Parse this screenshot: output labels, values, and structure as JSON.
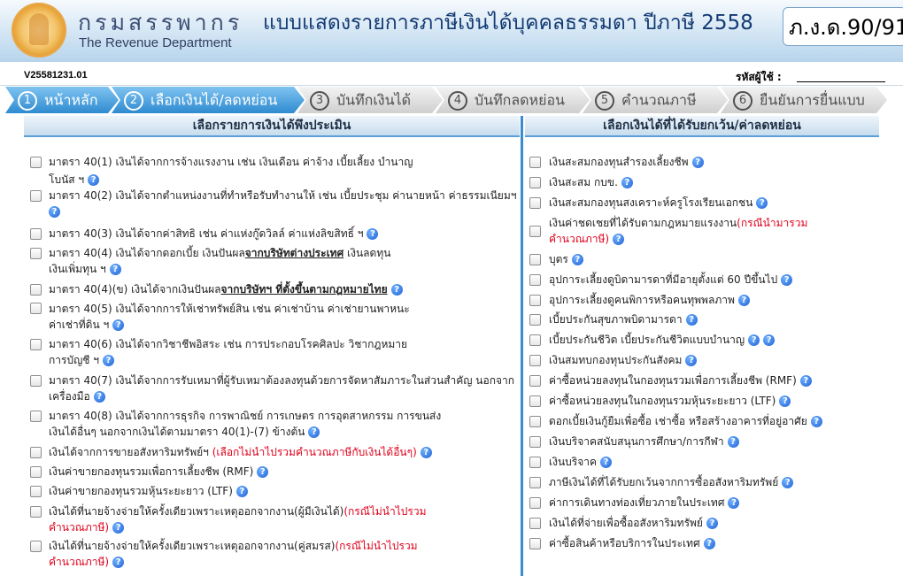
{
  "header": {
    "org_th": "กรมสรรพากร",
    "org_en": "The Revenue Department",
    "form_title": "แบบแสดงรายการภาษีเงินได้บุคคลธรรมดา ปีภาษี 2558",
    "form_code": "ภ.ง.ด.90/91"
  },
  "subheader": {
    "version": "V25581231.01",
    "user_label": "รหัสผู้ใช้ :"
  },
  "steps": [
    {
      "num": "1",
      "label": "หน้าหลัก",
      "active": true
    },
    {
      "num": "2",
      "label": "เลือกเงินได้/ลดหย่อน",
      "active": true
    },
    {
      "num": "3",
      "label": "บันทึกเงินได้",
      "active": false
    },
    {
      "num": "4",
      "label": "บันทึกลดหย่อน",
      "active": false
    },
    {
      "num": "5",
      "label": "คำนวณภาษี",
      "active": false
    },
    {
      "num": "6",
      "label": "ยืนยันการยื่นแบบ",
      "active": false
    }
  ],
  "left": {
    "title": "เลือกรายการเงินได้พึงประเมิน",
    "items": [
      {
        "a": "มาตรา 40(1) เงินได้จากการจ้างแรงงาน เช่น เงินเดือน ค่าจ้าง เบี้ยเลี้ยง บำนาญ",
        "b": "โบนัส ฯ"
      },
      {
        "a": "มาตรา 40(2) เงินได้จากตำแหน่งงานที่ทำหรือรับทำงานให้ เช่น เบี้ยประชุม ค่านายหน้า ค่าธรรมเนียมฯ",
        "b": ""
      },
      {
        "a": "มาตรา 40(3) เงินได้จากค่าสิทธิ เช่น ค่าแห่งกู๊ดวิลล์ ค่าแห่งลิขสิทธิ์ ฯ",
        "b": ""
      },
      {
        "a": "มาตรา 40(4) เงินได้จากดอกเบี้ย เงินปันผล",
        "a_ul": "จากบริษัทต่างประเทศ",
        "a_tail": " เงินลดทุน",
        "b": "เงินเพิ่มทุน ฯ"
      },
      {
        "a": "มาตรา 40(4)(ข) เงินได้จากเงินปันผล",
        "a_ul": "จากบริษัทฯ ที่ตั้งขึ้นตามกฎหมายไทย",
        "a_tail": "",
        "b": ""
      },
      {
        "a": "มาตรา 40(5) เงินได้จากการให้เช่าทรัพย์สิน เช่น ค่าเช่าบ้าน ค่าเช่ายานพาหนะ",
        "b": "ค่าเช่าที่ดิน ฯ"
      },
      {
        "a": "มาตรา 40(6) เงินได้จากวิชาชีพอิสระ เช่น การประกอบโรคศิลปะ วิชากฎหมาย",
        "b": "การบัญชี ฯ"
      },
      {
        "a": "มาตรา 40(7) เงินได้จากการรับเหมาที่ผู้รับเหมาต้องลงทุนด้วยการจัดหาสัมภาระในส่วนสำคัญ นอกจาก",
        "b": "เครื่องมือ"
      },
      {
        "a": "มาตรา 40(8) เงินได้จากการธุรกิจ การพาณิชย์ การเกษตร การอุตสาหกรรม การขนส่ง",
        "b": "เงินได้อื่นๆ นอกจากเงินได้ตามมาตรา 40(1)-(7) ข้างต้น"
      },
      {
        "a": "เงินได้จากการขายอสังหาริมทรัพย์ฯ",
        "red": " (เลือกไม่นำไปรวมคำนวณภาษีกับเงินได้อื่นๆ)",
        "b": ""
      },
      {
        "a": "เงินค่าขายกองทุนรวมเพื่อการเลี้ยงชีพ (RMF)",
        "b": ""
      },
      {
        "a": "เงินค่าขายกองทุนรวมหุ้นระยะยาว (LTF)",
        "b": ""
      },
      {
        "a": "เงินได้ที่นายจ้างจ่ายให้ครั้งเดียวเพราะเหตุออกจากงาน(ผู้มีเงินได้)",
        "red": "(กรณีไม่นำไปรวม",
        "b_red": "คำนวณภาษี)"
      },
      {
        "a": "เงินได้ที่นายจ้างจ่ายให้ครั้งเดียวเพราะเหตุออกจากงาน(คู่สมรส)",
        "red": "(กรณีไม่นำไปรวม",
        "b_red": "คำนวณภาษี)"
      }
    ]
  },
  "right": {
    "title": "เลือกเงินได้ที่ได้รับยกเว้น/ค่าลดหย่อน",
    "items": [
      {
        "a": "เงินสะสมกองทุนสำรองเลี้ยงชีพ"
      },
      {
        "a": "เงินสะสม กบข."
      },
      {
        "a": "เงินสะสมกองทุนสงเคราะห์ครูโรงเรียนเอกชน"
      },
      {
        "a": "เงินค่าชดเชยที่ได้รับตามกฎหมายแรงงาน",
        "red": "(กรณีนำมารวม",
        "b_red": "คำนวณภาษี)"
      },
      {
        "a": "บุตร"
      },
      {
        "a": "อุปการะเลี้ยงดูบิดามารดาที่มีอายุตั้งแต่ 60 ปีขึ้นไป"
      },
      {
        "a": "อุปการะเลี้ยงดูคนพิการหรือคนทุพพลภาพ"
      },
      {
        "a": "เบี้ยประกันสุขภาพบิดามารดา"
      },
      {
        "a": "เบี้ยประกันชีวิต เบี้ยประกันชีวิตแบบบำนาญ",
        "q2": true
      },
      {
        "a": "เงินสมทบกองทุนประกันสังคม"
      },
      {
        "a": "ค่าซื้อหน่วยลงทุนในกองทุนรวมเพื่อการเลี้ยงชีพ (RMF)"
      },
      {
        "a": "ค่าซื้อหน่วยลงทุนในกองทุนรวมหุ้นระยะยาว (LTF)"
      },
      {
        "a": "ดอกเบี้ยเงินกู้ยืมเพื่อซื้อ เช่าซื้อ หรือสร้างอาคารที่อยู่อาศัย"
      },
      {
        "a": "เงินบริจาคสนับสนุนการศึกษา/การกีฬา"
      },
      {
        "a": "เงินบริจาค"
      },
      {
        "a": "ภาษีเงินได้ที่ได้รับยกเว้นจากการซื้ออสังหาริมทรัพย์"
      },
      {
        "a": "ค่าการเดินทางท่องเที่ยวภายในประเทศ"
      },
      {
        "a": "เงินได้ที่จ่ายเพื่อซื้ออสังหาริมทรัพย์"
      },
      {
        "a": "ค่าซื้อสินค้าหรือบริการในประเทศ"
      }
    ]
  },
  "colors": {
    "accent": "#2f8bd0",
    "divider": "#3a8bd2",
    "red_note": "#e0001b",
    "help_icon": "#1f5fd4"
  },
  "icons": {
    "help": "question-circle-icon",
    "logo": "revenue-department-emblem-icon"
  }
}
